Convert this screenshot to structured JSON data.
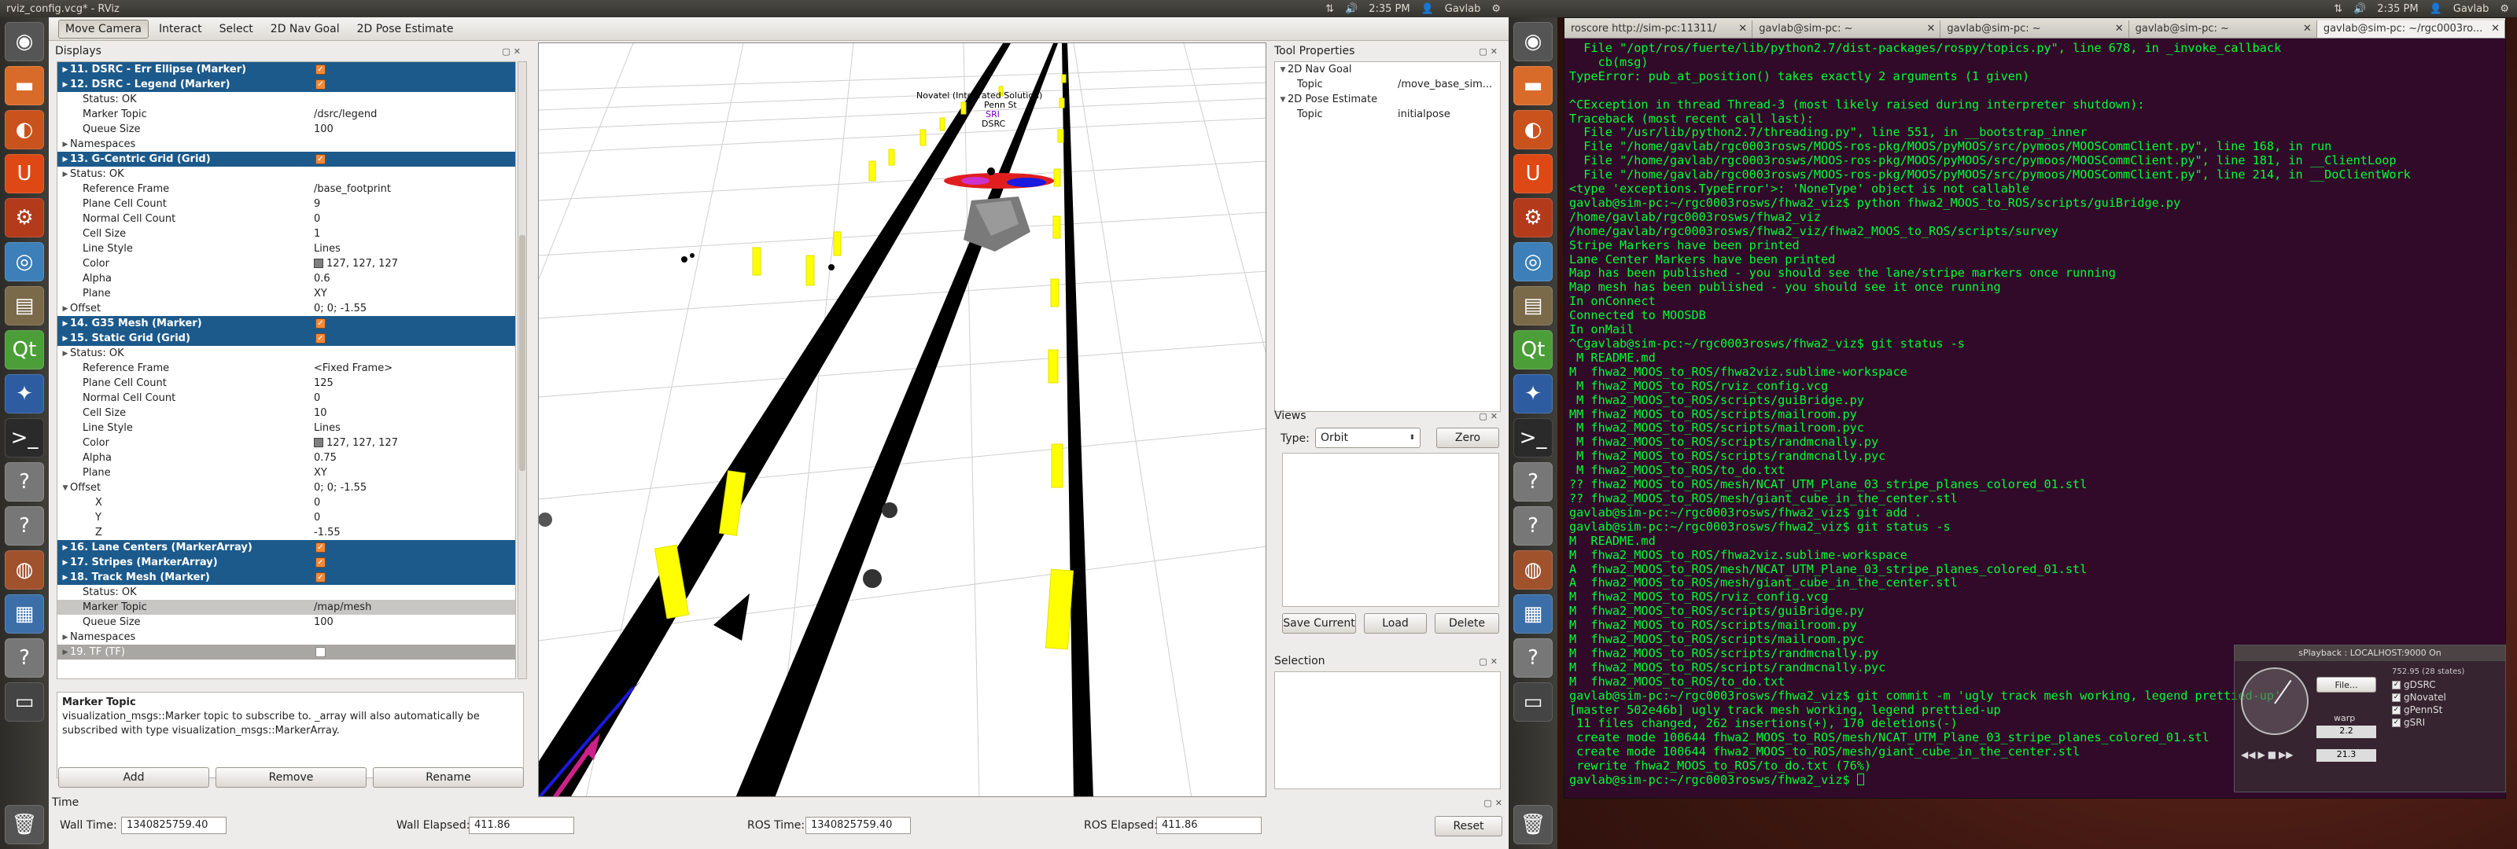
{
  "left_panel": {
    "title": "rviz_config.vcg* - RViz",
    "time": "2:35 PM",
    "user": "Gavlab"
  },
  "right_panel": {
    "time": "2:35 PM",
    "user": "Gavlab"
  },
  "toolbar": {
    "tools": [
      "Move Camera",
      "Interact",
      "Select",
      "2D Nav Goal",
      "2D Pose Estimate"
    ]
  },
  "displays": {
    "title": "Displays",
    "rows": [
      {
        "kind": "group",
        "label": "11. DSRC - Err Ellipse (Marker)",
        "check": true
      },
      {
        "kind": "group",
        "label": "12. DSRC - Legend (Marker)",
        "check": true
      },
      {
        "kind": "item",
        "indent": 2,
        "label": "Status: OK",
        "value": ""
      },
      {
        "kind": "item",
        "indent": 2,
        "label": "Marker Topic",
        "value": "/dsrc/legend"
      },
      {
        "kind": "item",
        "indent": 2,
        "label": "Queue Size",
        "value": "100"
      },
      {
        "kind": "item",
        "indent": 1,
        "label": "Namespaces",
        "value": "",
        "arrow": "▶"
      },
      {
        "kind": "group",
        "label": "13. G-Centric Grid (Grid)",
        "check": true
      },
      {
        "kind": "item",
        "indent": 1,
        "label": "Status: OK",
        "value": "",
        "arrow": "▶"
      },
      {
        "kind": "item",
        "indent": 2,
        "label": "Reference Frame",
        "value": "/base_footprint"
      },
      {
        "kind": "item",
        "indent": 2,
        "label": "Plane Cell Count",
        "value": "9"
      },
      {
        "kind": "item",
        "indent": 2,
        "label": "Normal Cell Count",
        "value": "0"
      },
      {
        "kind": "item",
        "indent": 2,
        "label": "Cell Size",
        "value": "1"
      },
      {
        "kind": "item",
        "indent": 2,
        "label": "Line Style",
        "value": "Lines"
      },
      {
        "kind": "item",
        "indent": 2,
        "label": "Color",
        "value": "127, 127, 127",
        "swatch": true
      },
      {
        "kind": "item",
        "indent": 2,
        "label": "Alpha",
        "value": "0.6"
      },
      {
        "kind": "item",
        "indent": 2,
        "label": "Plane",
        "value": "XY"
      },
      {
        "kind": "item",
        "indent": 1,
        "label": "Offset",
        "value": "0; 0; -1.55",
        "arrow": "▶"
      },
      {
        "kind": "group",
        "label": "14. G35 Mesh (Marker)",
        "check": true
      },
      {
        "kind": "group",
        "label": "15. Static Grid (Grid)",
        "check": true
      },
      {
        "kind": "item",
        "indent": 1,
        "label": "Status: OK",
        "value": "",
        "arrow": "▶"
      },
      {
        "kind": "item",
        "indent": 2,
        "label": "Reference Frame",
        "value": "<Fixed Frame>"
      },
      {
        "kind": "item",
        "indent": 2,
        "label": "Plane Cell Count",
        "value": "125"
      },
      {
        "kind": "item",
        "indent": 2,
        "label": "Normal Cell Count",
        "value": "0"
      },
      {
        "kind": "item",
        "indent": 2,
        "label": "Cell Size",
        "value": "10"
      },
      {
        "kind": "item",
        "indent": 2,
        "label": "Line Style",
        "value": "Lines"
      },
      {
        "kind": "item",
        "indent": 2,
        "label": "Color",
        "value": "127, 127, 127",
        "swatch": true
      },
      {
        "kind": "item",
        "indent": 2,
        "label": "Alpha",
        "value": "0.75"
      },
      {
        "kind": "item",
        "indent": 2,
        "label": "Plane",
        "value": "XY"
      },
      {
        "kind": "item",
        "indent": 1,
        "label": "Offset",
        "value": "0; 0; -1.55",
        "arrow": "▼"
      },
      {
        "kind": "item",
        "indent": 3,
        "label": "X",
        "value": "0"
      },
      {
        "kind": "item",
        "indent": 3,
        "label": "Y",
        "value": "0"
      },
      {
        "kind": "item",
        "indent": 3,
        "label": "Z",
        "value": "-1.55"
      },
      {
        "kind": "group",
        "label": "16. Lane Centers (MarkerArray)",
        "check": true
      },
      {
        "kind": "group",
        "label": "17. Stripes (MarkerArray)",
        "check": true
      },
      {
        "kind": "group",
        "label": "18. Track Mesh (Marker)",
        "check": true
      },
      {
        "kind": "item",
        "indent": 2,
        "label": "Status: OK",
        "value": ""
      },
      {
        "kind": "sel",
        "indent": 2,
        "label": "Marker Topic",
        "value": "/map/mesh"
      },
      {
        "kind": "item",
        "indent": 2,
        "label": "Queue Size",
        "value": "100"
      },
      {
        "kind": "item",
        "indent": 1,
        "label": "Namespaces",
        "value": "",
        "arrow": "▶"
      },
      {
        "kind": "gray",
        "label": "19. TF (TF)",
        "check": false
      }
    ],
    "help_title": "Marker Topic",
    "help_text": "visualization_msgs::Marker topic to subscribe to. _array will also automatically be subscribed with type visualization_msgs::MarkerArray.",
    "add": "Add",
    "remove": "Remove",
    "rename": "Rename"
  },
  "viewport": {
    "legend": [
      "Novatel (Integrated Solution)",
      "Penn St",
      "SRI",
      "DSRC"
    ]
  },
  "tool_properties": {
    "title": "Tool Properties",
    "rows": [
      {
        "label": "2D Nav Goal",
        "value": "",
        "indent": 0
      },
      {
        "label": "Topic",
        "value": "/move_base_sim...",
        "indent": 1
      },
      {
        "label": "2D Pose Estimate",
        "value": "",
        "indent": 0
      },
      {
        "label": "Topic",
        "value": "initialpose",
        "indent": 1
      }
    ]
  },
  "views": {
    "title": "Views",
    "type_label": "Type:",
    "type_value": "Orbit",
    "zero": "Zero",
    "save": "Save Current",
    "load": "Load",
    "delete": "Delete"
  },
  "selection": {
    "title": "Selection"
  },
  "time_panel": {
    "title": "Time",
    "wall_time_label": "Wall Time:",
    "wall_time": "1340825759.40",
    "wall_elapsed_label": "Wall Elapsed:",
    "wall_elapsed": "411.86",
    "ros_time_label": "ROS Time:",
    "ros_time": "1340825759.40",
    "ros_elapsed_label": "ROS Elapsed:",
    "ros_elapsed": "411.86",
    "reset": "Reset"
  },
  "terminal": {
    "tabs": [
      "roscore http://sim-pc:11311/",
      "gavlab@sim-pc: ~",
      "gavlab@sim-pc: ~",
      "gavlab@sim-pc: ~",
      "gavlab@sim-pc: ~/rgc0003ro..."
    ],
    "lines": [
      "  File \"/opt/ros/fuerte/lib/python2.7/dist-packages/rospy/topics.py\", line 678, in _invoke_callback",
      "    cb(msg)",
      "TypeError: pub_at_position() takes exactly 2 arguments (1 given)",
      "",
      "^CException in thread Thread-3 (most likely raised during interpreter shutdown):",
      "Traceback (most recent call last):",
      "  File \"/usr/lib/python2.7/threading.py\", line 551, in __bootstrap_inner",
      "  File \"/home/gavlab/rgc0003rosws/MOOS-ros-pkg/MOOS/pyMOOS/src/pymoos/MOOSCommClient.py\", line 168, in run",
      "  File \"/home/gavlab/rgc0003rosws/MOOS-ros-pkg/MOOS/pyMOOS/src/pymoos/MOOSCommClient.py\", line 181, in __ClientLoop",
      "  File \"/home/gavlab/rgc0003rosws/MOOS-ros-pkg/MOOS/pyMOOS/src/pymoos/MOOSCommClient.py\", line 214, in __DoClientWork",
      "<type 'exceptions.TypeError'>: 'NoneType' object is not callable",
      "gavlab@sim-pc:~/rgc0003rosws/fhwa2_viz$ python fhwa2_MOOS_to_ROS/scripts/guiBridge.py",
      "/home/gavlab/rgc0003rosws/fhwa2_viz",
      "/home/gavlab/rgc0003rosws/fhwa2_viz/fhwa2_MOOS_to_ROS/scripts/survey",
      "Stripe Markers have been printed",
      "Lane Center Markers have been printed",
      "Map has been published - you should see the lane/stripe markers once running",
      "Map mesh has been published - you should see it once running",
      "In onConnect",
      "Connected to MOOSDB",
      "In onMail",
      "^Cgavlab@sim-pc:~/rgc0003rosws/fhwa2_viz$ git status -s",
      " M README.md",
      "M  fhwa2_MOOS_to_ROS/fhwa2viz.sublime-workspace",
      " M fhwa2_MOOS_to_ROS/rviz_config.vcg",
      " M fhwa2_MOOS_to_ROS/scripts/guiBridge.py",
      "MM fhwa2_MOOS_to_ROS/scripts/mailroom.py",
      " M fhwa2_MOOS_to_ROS/scripts/mailroom.pyc",
      " M fhwa2_MOOS_to_ROS/scripts/randmcnally.py",
      " M fhwa2_MOOS_to_ROS/scripts/randmcnally.pyc",
      " M fhwa2_MOOS_to_ROS/to_do.txt",
      "?? fhwa2_MOOS_to_ROS/mesh/NCAT_UTM_Plane_03_stripe_planes_colored_01.stl",
      "?? fhwa2_MOOS_to_ROS/mesh/giant_cube_in_the_center.stl",
      "gavlab@sim-pc:~/rgc0003rosws/fhwa2_viz$ git add .",
      "gavlab@sim-pc:~/rgc0003rosws/fhwa2_viz$ git status -s",
      "M  README.md",
      "M  fhwa2_MOOS_to_ROS/fhwa2viz.sublime-workspace",
      "A  fhwa2_MOOS_to_ROS/mesh/NCAT_UTM_Plane_03_stripe_planes_colored_01.stl",
      "A  fhwa2_MOOS_to_ROS/mesh/giant_cube_in_the_center.stl",
      "M  fhwa2_MOOS_to_ROS/rviz_config.vcg",
      "M  fhwa2_MOOS_to_ROS/scripts/guiBridge.py",
      "M  fhwa2_MOOS_to_ROS/scripts/mailroom.py",
      "M  fhwa2_MOOS_to_ROS/scripts/mailroom.pyc",
      "M  fhwa2_MOOS_to_ROS/scripts/randmcnally.py",
      "M  fhwa2_MOOS_to_ROS/scripts/randmcnally.pyc",
      "M  fhwa2_MOOS_to_ROS/to_do.txt",
      "gavlab@sim-pc:~/rgc0003rosws/fhwa2_viz$ git commit -m 'ugly track mesh working, legend prettied-up'",
      "[master 502e46b] ugly track mesh working, legend prettied-up",
      " 11 files changed, 262 insertions(+), 170 deletions(-)",
      " create mode 100644 fhwa2_MOOS_to_ROS/mesh/NCAT_UTM_Plane_03_stripe_planes_colored_01.stl",
      " create mode 100644 fhwa2_MOOS_to_ROS/mesh/giant_cube_in_the_center.stl",
      " rewrite fhwa2_MOOS_to_ROS/to_do.txt (76%)",
      "gavlab@sim-pc:~/rgc0003rosws/fhwa2_viz$ "
    ]
  },
  "mini_window": {
    "title": "sPlayback : LOCALHOST:9000 On",
    "file_btn": "File...",
    "warp_label": "warp",
    "warp_value": "2.2",
    "items": [
      "gDSRC",
      "gNovatel",
      "gPennSt",
      "gSRI"
    ],
    "counter": "752.95 (28 states)",
    "time_value": "21.3"
  }
}
